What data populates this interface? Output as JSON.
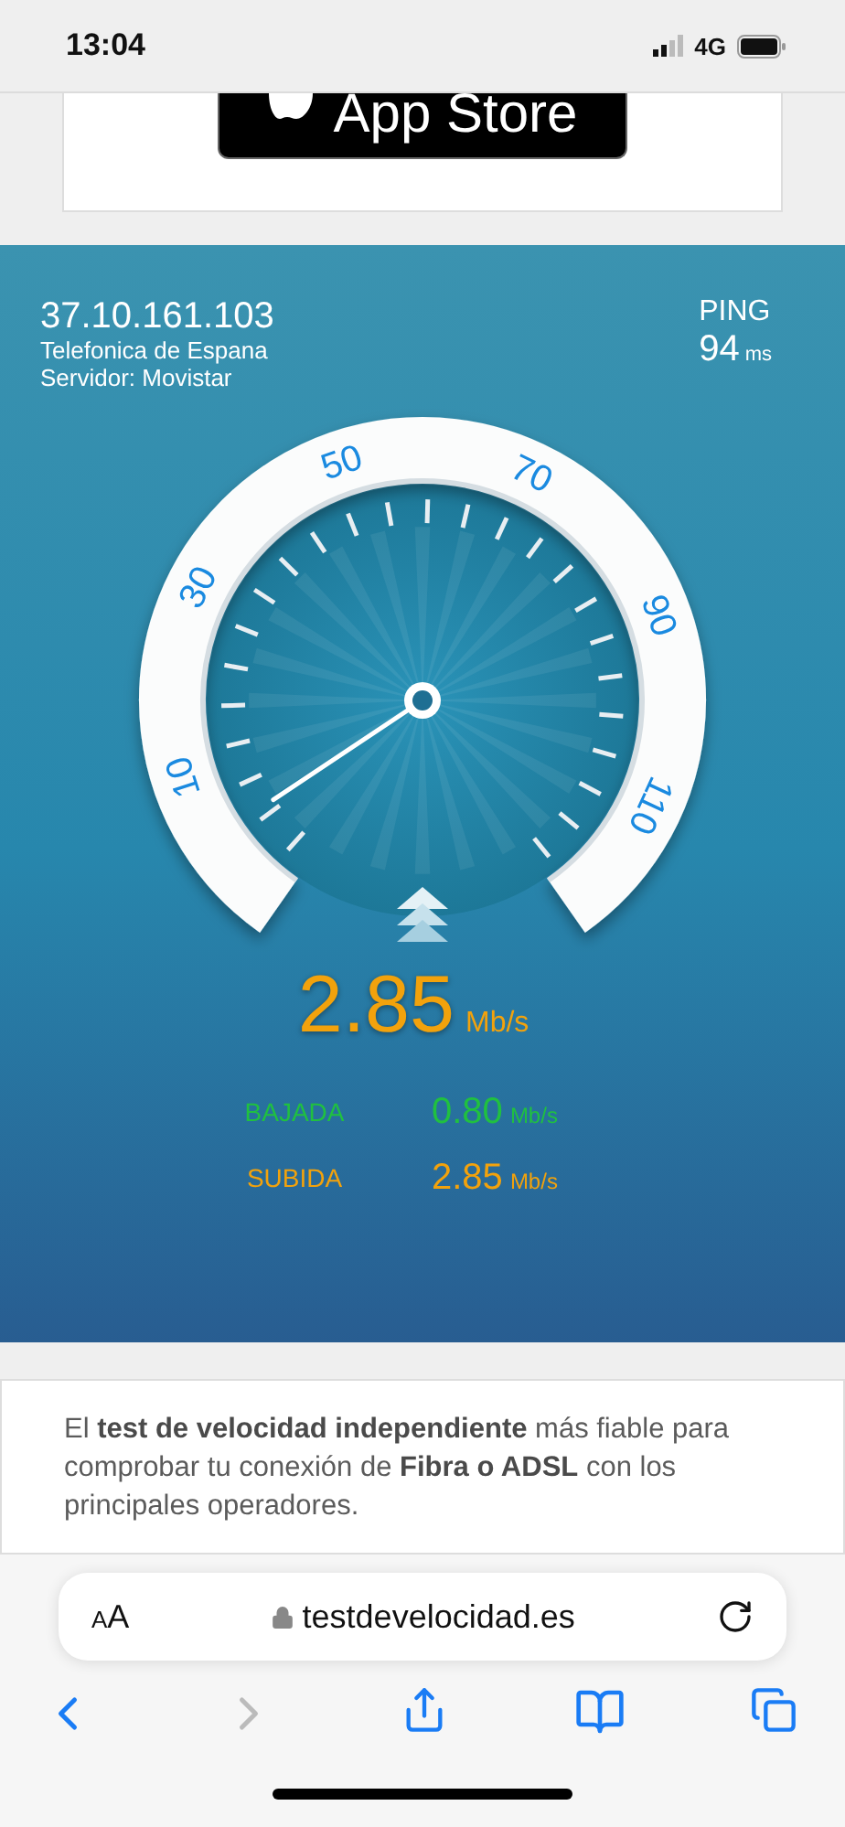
{
  "status_bar": {
    "time": "13:04",
    "network": "4G"
  },
  "app_store_badge": {
    "label": "App Store"
  },
  "speed_test": {
    "ip": "37.10.161.103",
    "isp": "Telefonica de Espana",
    "server": "Servidor: Movistar",
    "ping_label": "PING",
    "ping_value": "94",
    "ping_unit": "ms",
    "gauge": {
      "scale": [
        "10",
        "30",
        "50",
        "70",
        "90",
        "110"
      ]
    },
    "speed": {
      "value": "2.85",
      "unit": "Mb/s"
    },
    "results": [
      {
        "kind": "download",
        "label": "BAJADA",
        "value": "0.80",
        "unit": "Mb/s"
      },
      {
        "kind": "upload",
        "label": "SUBIDA",
        "value": "2.85",
        "unit": "Mb/s"
      }
    ]
  },
  "description": "El **test de velocidad independiente** más fiable para comprobar tu conexión de **Fibra o ADSL** con los principales operadores.",
  "browser": {
    "text_size": "AA",
    "url": "testdevelocidad.es"
  }
}
